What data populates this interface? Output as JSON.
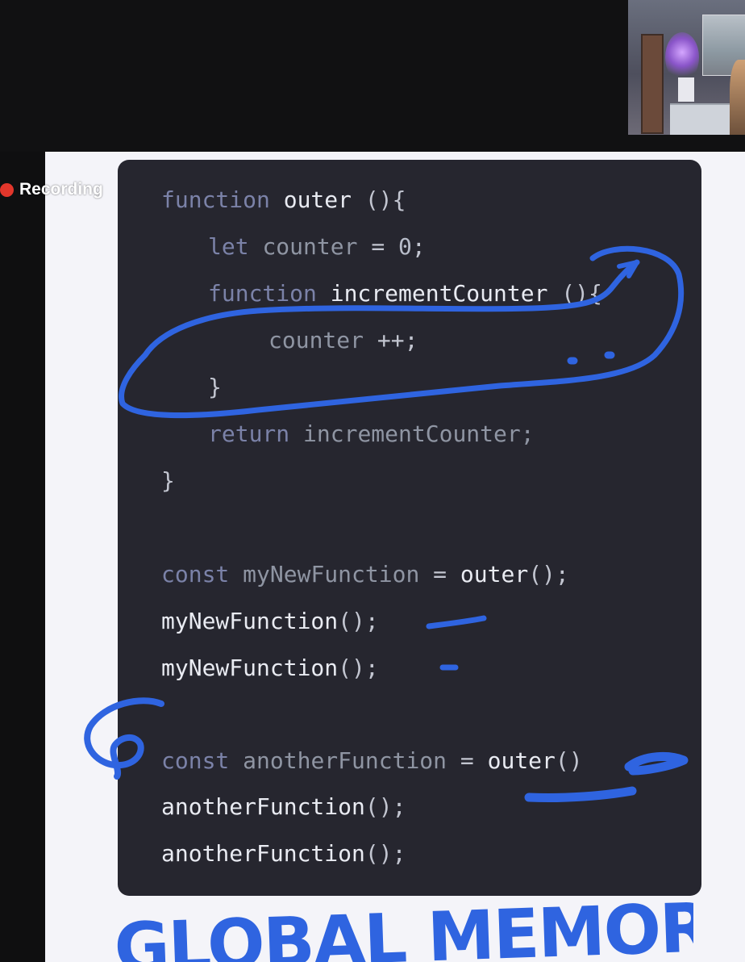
{
  "recording": {
    "label": "Recording"
  },
  "colors": {
    "accent": "#2f64e0",
    "recording_dot": "#e2362b",
    "card_background": "#26262f",
    "slide_background": "#f4f4f9",
    "keyword": "#7b82a8",
    "identifier": "#8f95a3",
    "function_name": "#e9ebf2"
  },
  "code": {
    "l1": {
      "kw": "function",
      "name": "outer",
      "punc": "(){"
    },
    "l2": {
      "kw": "let",
      "id": "counter",
      "eq": "=",
      "num": "0",
      "end": ";"
    },
    "l3": {
      "kw": "function",
      "name": "incrementCounter",
      "punc": "(){"
    },
    "l4": {
      "id": "counter",
      "op": "++;"
    },
    "l5": {
      "brace": "}"
    },
    "l6": {
      "kw": "return",
      "id": "incrementCounter;"
    },
    "l7": {
      "brace": "}"
    },
    "l8": {
      "kw": "const",
      "id": "myNewFunction",
      "eq": "=",
      "name": "outer",
      "punc": "();"
    },
    "l9": {
      "name": "myNewFunction",
      "punc": "();"
    },
    "l10": {
      "name": "myNewFunction",
      "punc": "();"
    },
    "l11": {
      "kw": "const",
      "id": "anotherFunction",
      "eq": "=",
      "name": "outer",
      "punc": "()"
    },
    "l12": {
      "name": "anotherFunction",
      "punc": "();"
    },
    "l13": {
      "name": "anotherFunction",
      "punc": "();"
    }
  },
  "annotations": {
    "handwritten_text": "GLOBAL MEMORY"
  }
}
